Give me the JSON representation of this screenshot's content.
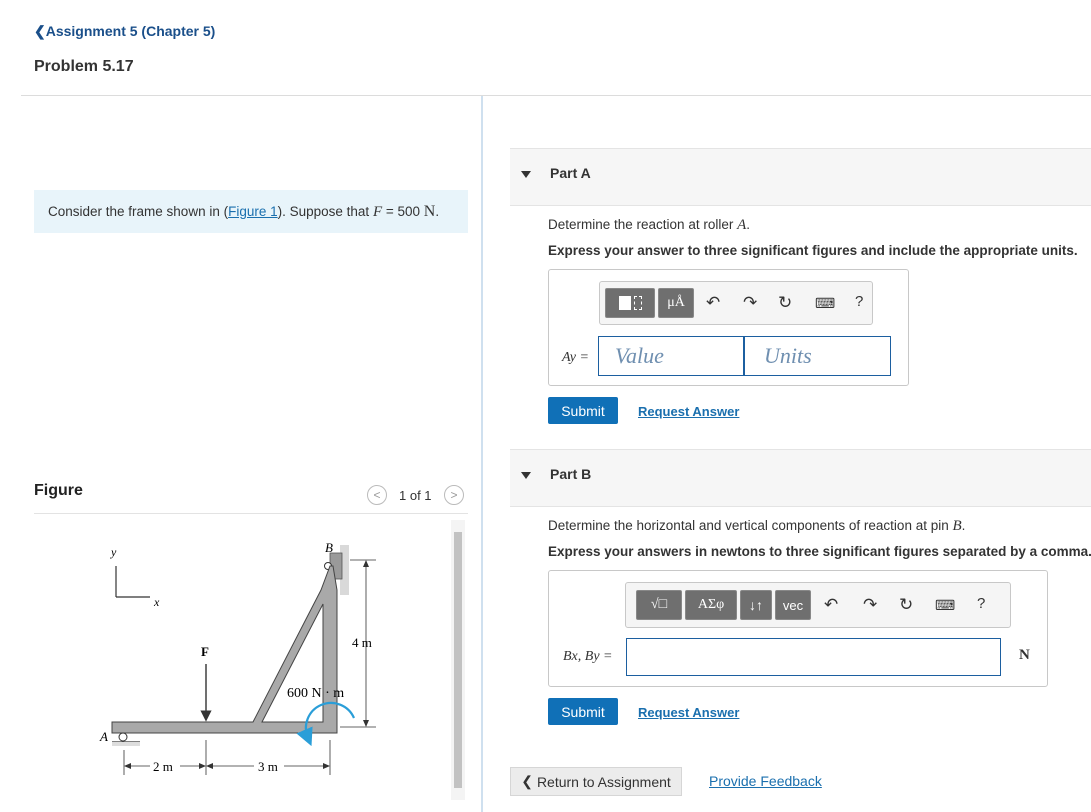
{
  "nav": {
    "back_link": "Assignment 5 (Chapter 5)",
    "problem_title": "Problem 5.17"
  },
  "intro": {
    "text_before": "Consider the frame shown in (",
    "figure_link": "Figure 1",
    "text_middle": "). Suppose that ",
    "var": "F",
    "equals": " = 500 ",
    "unit": "N",
    "period": "."
  },
  "figure_panel": {
    "label": "Figure",
    "pager": "1 of 1",
    "labels": {
      "axis_y": "y",
      "axis_x": "x",
      "point_a": "A",
      "point_b": "B",
      "force": "F",
      "height": "4 m",
      "moment": "600 N · m",
      "dim_1": "2 m",
      "dim_2": "3 m"
    }
  },
  "part_a": {
    "title": "Part A",
    "question_before": "Determine the reaction at roller ",
    "question_var": "A",
    "question_after": ".",
    "instruction": "Express your answer to three significant figures and include the appropriate units.",
    "answer_label": "Ay =",
    "value_placeholder": "Value",
    "units_placeholder": "Units",
    "toolbar": {
      "templates_icon": "templates-icon",
      "units_button": "μÅ",
      "help": "?"
    },
    "submit": "Submit",
    "request_answer": "Request Answer"
  },
  "part_b": {
    "title": "Part B",
    "question_before": "Determine the horizontal and vertical components of reaction at pin ",
    "question_var": "B",
    "question_after": ".",
    "instruction": "Express your answers in newtons to three significant figures separated by a comma.",
    "answer_label": "Bx, By =",
    "unit": "N",
    "toolbar": {
      "sqrt_button": "√□",
      "greek_button": "ΑΣφ",
      "arrows_button": "↓↑",
      "vec_button": "vec",
      "help": "?"
    },
    "submit": "Submit",
    "request_answer": "Request Answer"
  },
  "footer": {
    "return_button": "Return to Assignment",
    "feedback_link": "Provide Feedback"
  },
  "colors": {
    "primary": "#1070b7",
    "intro_bg": "#e8f4fa",
    "link": "#1a6fae",
    "field_border": "#1c5fa0"
  }
}
